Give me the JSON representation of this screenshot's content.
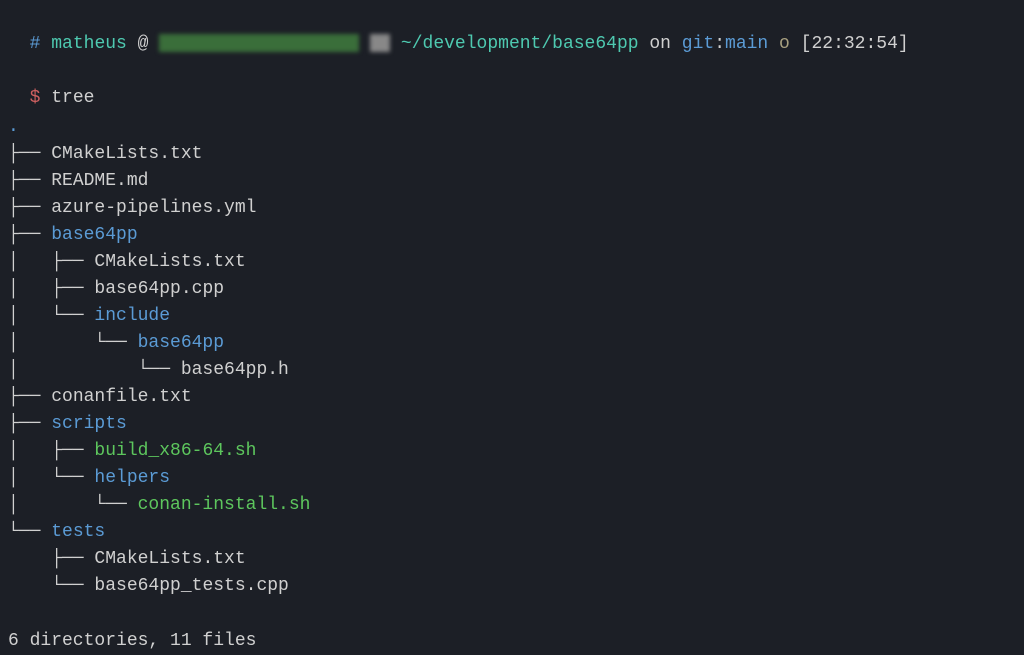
{
  "prompt": {
    "hash": "#",
    "user": "matheus",
    "at": "@",
    "path": "~/development/base64pp",
    "on": "on",
    "git_label": "git",
    "git_colon": ":",
    "git_branch": "main",
    "marker": "o",
    "timestamp": "[22:32:54]",
    "dollar": "$",
    "command": "tree"
  },
  "tree": {
    "root": ".",
    "lines": [
      {
        "prefix": "├── ",
        "name": "CMakeLists.txt",
        "type": "file"
      },
      {
        "prefix": "├── ",
        "name": "README.md",
        "type": "file"
      },
      {
        "prefix": "├── ",
        "name": "azure-pipelines.yml",
        "type": "file"
      },
      {
        "prefix": "├── ",
        "name": "base64pp",
        "type": "dir"
      },
      {
        "prefix": "│   ├── ",
        "name": "CMakeLists.txt",
        "type": "file"
      },
      {
        "prefix": "│   ├── ",
        "name": "base64pp.cpp",
        "type": "file"
      },
      {
        "prefix": "│   └── ",
        "name": "include",
        "type": "dir"
      },
      {
        "prefix": "│       └── ",
        "name": "base64pp",
        "type": "dir"
      },
      {
        "prefix": "│           └── ",
        "name": "base64pp.h",
        "type": "file"
      },
      {
        "prefix": "├── ",
        "name": "conanfile.txt",
        "type": "file"
      },
      {
        "prefix": "├── ",
        "name": "scripts",
        "type": "dir"
      },
      {
        "prefix": "│   ├── ",
        "name": "build_x86-64.sh",
        "type": "exec"
      },
      {
        "prefix": "│   └── ",
        "name": "helpers",
        "type": "dir"
      },
      {
        "prefix": "│       └── ",
        "name": "conan-install.sh",
        "type": "exec"
      },
      {
        "prefix": "└── ",
        "name": "tests",
        "type": "dir"
      },
      {
        "prefix": "    ├── ",
        "name": "CMakeLists.txt",
        "type": "file"
      },
      {
        "prefix": "    └── ",
        "name": "base64pp_tests.cpp",
        "type": "file"
      }
    ],
    "summary": "6 directories, 11 files"
  }
}
